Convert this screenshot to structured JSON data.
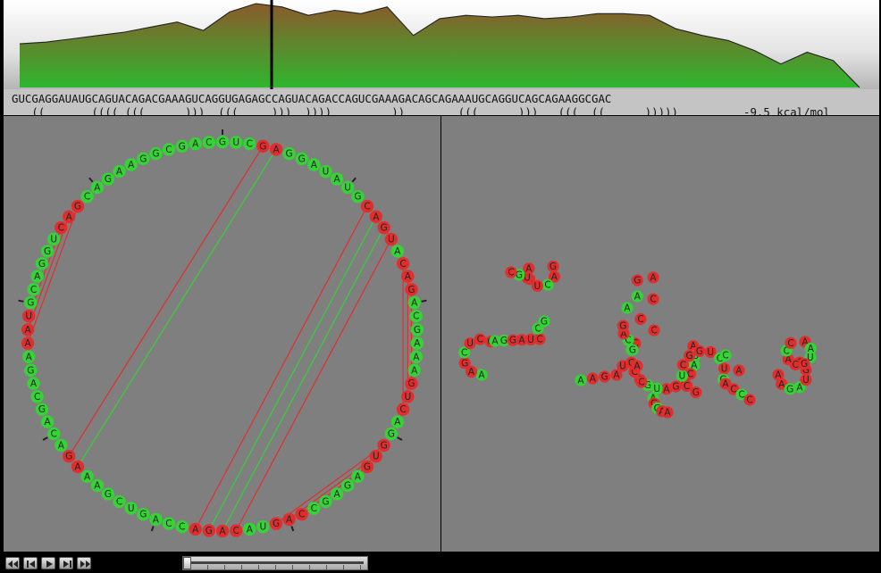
{
  "sequence": "GUCGAGGAUAUGCAGUACAGACGAAAGUCAGGUGAGAGCCAGUACAGACCAGUCGAAAGACAGCAGAAAUGCAGGUCAGCAGAAGGCGAC",
  "structure": "   ((       (((( (((      )))  (((     )))  ))))         ))        (((      )))   (((  ((      )))))",
  "energy_label": "-9.5 kcal/mol",
  "colors": {
    "paired": "#e02e2e",
    "unpaired": "#36d336",
    "profile_top": "#8b5a2b",
    "profile_bottom": "#2fb62f",
    "panel_bg": "#7f7f7f"
  },
  "profile": {
    "cursor_fraction": 0.3,
    "heights": [
      0.52,
      0.54,
      0.58,
      0.62,
      0.66,
      0.72,
      0.78,
      0.68,
      0.9,
      1.0,
      0.96,
      0.86,
      0.92,
      0.88,
      0.96,
      0.62,
      0.82,
      0.86,
      0.84,
      0.86,
      0.82,
      0.84,
      0.88,
      0.88,
      0.86,
      0.7,
      0.62,
      0.56,
      0.44,
      0.28,
      0.42,
      0.32,
      0.0
    ]
  },
  "playback": {
    "buttons": [
      "first-frame",
      "previous-frame",
      "play",
      "next-frame",
      "last-frame"
    ],
    "slider_position": 0.0
  },
  "tree_view": {
    "labels": [
      "A",
      "A",
      "G",
      "A",
      "U",
      "G",
      "C",
      "C",
      "A",
      "G",
      "A",
      "C",
      "C",
      "A",
      "G",
      "A",
      "C",
      "A",
      "G",
      "A",
      "U",
      "G",
      "A",
      "C",
      "C",
      "G",
      "A",
      "C",
      "A",
      "G",
      "G",
      "A",
      "A",
      "G",
      "C",
      "U",
      "C",
      "G",
      "G",
      "U",
      "C",
      "U",
      "G",
      "A",
      "C",
      "C",
      "C",
      "A",
      "A",
      "G",
      "A",
      "U",
      "G",
      "C",
      "A",
      "A",
      "U",
      "G",
      "C",
      "A",
      "C",
      "C",
      "A",
      "C",
      "C",
      "A",
      "G",
      "A",
      "G",
      "A",
      "C",
      "U",
      "G",
      "A",
      "U",
      "G",
      "C",
      "A",
      "A",
      "G",
      "C",
      "U",
      "C",
      "C",
      "A",
      "G",
      "G",
      "A",
      "U",
      "C",
      "C",
      "G",
      "A",
      "A",
      "G"
    ]
  }
}
